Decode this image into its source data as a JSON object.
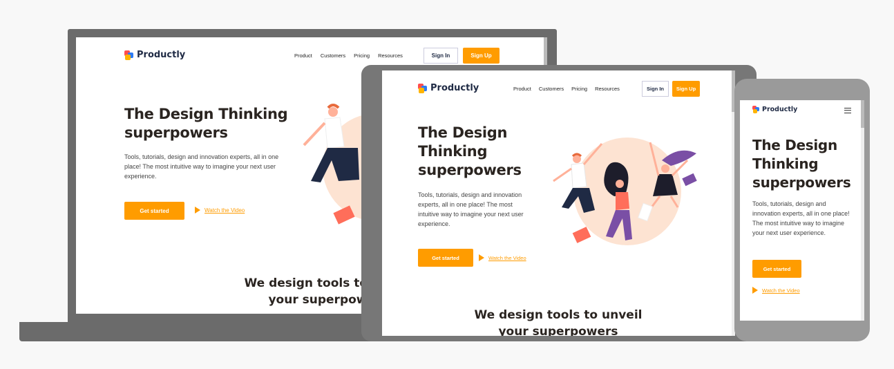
{
  "brand": {
    "name": "Productly",
    "logo_colors": [
      "#ff4d4d",
      "#2d7bf4",
      "#ffb400"
    ]
  },
  "nav": {
    "items": [
      "Product",
      "Customers",
      "Pricing",
      "Resources"
    ],
    "sign_in_label": "Sign In",
    "sign_up_label": "Sign Up"
  },
  "hero": {
    "title_line1": "The Design Thinking",
    "title_line2": "superpowers",
    "tablet_title_1": "The Design",
    "tablet_title_2": "Thinking",
    "tablet_title_3": "superpowers",
    "description": "Tools, tutorials, design and innovation experts, all in one place! The most intuitive way to imagine your next user experience.",
    "cta_label": "Get started",
    "video_label": "Watch the Video"
  },
  "section": {
    "title_line1": "We design tools to unveil",
    "title_line2": "your superpowers"
  },
  "colors": {
    "accent": "#ff9c00",
    "heading": "#2a2420",
    "navy": "#1f2a44",
    "device_frame": "#6b6b6b",
    "blob": "#fde3d2"
  }
}
